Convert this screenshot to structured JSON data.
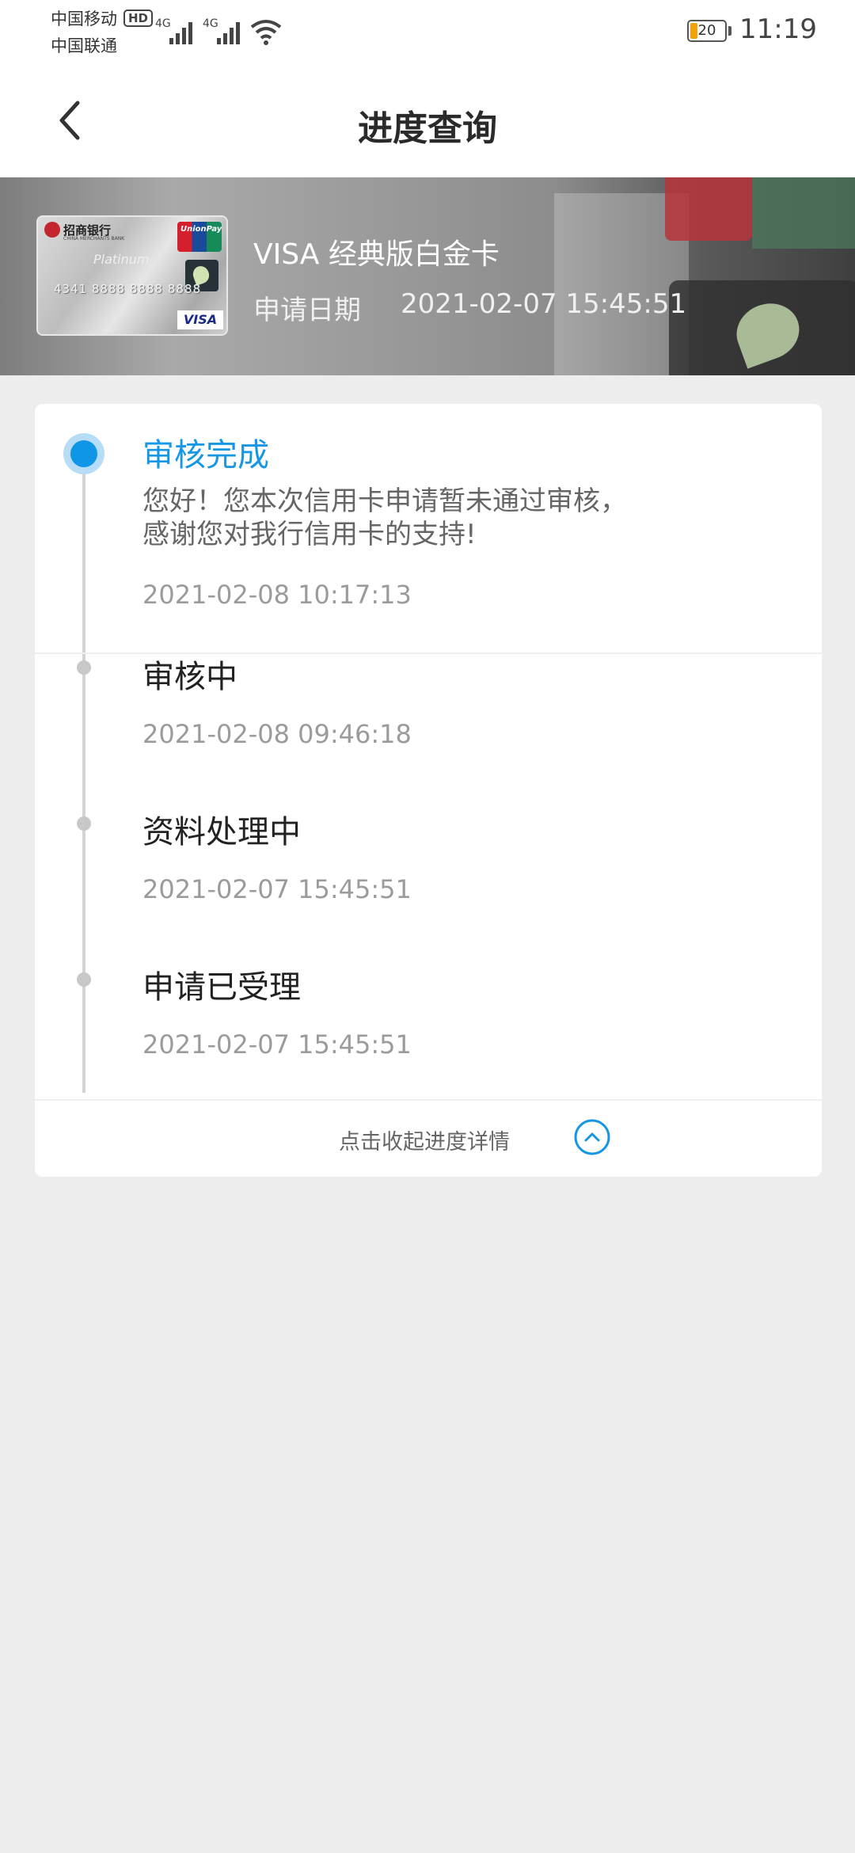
{
  "status_bar": {
    "carrier_1": "中国移动",
    "carrier_2": "中国联通",
    "hd_badge": "HD",
    "signal_1": "4G",
    "signal_2": "4G",
    "battery_level": "20",
    "time": "11:19",
    "icons": [
      "signal-icon",
      "wifi-icon",
      "battery-icon"
    ]
  },
  "nav": {
    "title": "进度查询",
    "back_icon": "chevron-left-icon"
  },
  "card": {
    "name": "VISA 经典版白金卡",
    "apply_label": "申请日期",
    "apply_date": "2021-02-07 15:45:51",
    "image": {
      "bank": "招商银行",
      "bank_en": "CHINA MERCHANTS BANK",
      "unionpay": "UnionPay",
      "number": "4341 8888 8888 8888",
      "platinum": "Platinum",
      "network": "VISA"
    }
  },
  "progress": {
    "steps": [
      {
        "title": "审核完成",
        "message": "您好！您本次信用卡申请暂未通过审核，感谢您对我行信用卡的支持!",
        "time": "2021-02-08 10:17:13",
        "active": true
      },
      {
        "title": "审核中",
        "time": "2021-02-08 09:46:18",
        "active": false
      },
      {
        "title": "资料处理中",
        "time": "2021-02-07 15:45:51",
        "active": false
      },
      {
        "title": "申请已受理",
        "time": "2021-02-07 15:45:51",
        "active": false
      }
    ],
    "collapse_label": "点击收起进度详情",
    "collapse_icon": "chevron-up-circle-icon"
  },
  "colors": {
    "accent": "#1597e5",
    "background": "#ededed",
    "battery": "#f2a20b"
  }
}
